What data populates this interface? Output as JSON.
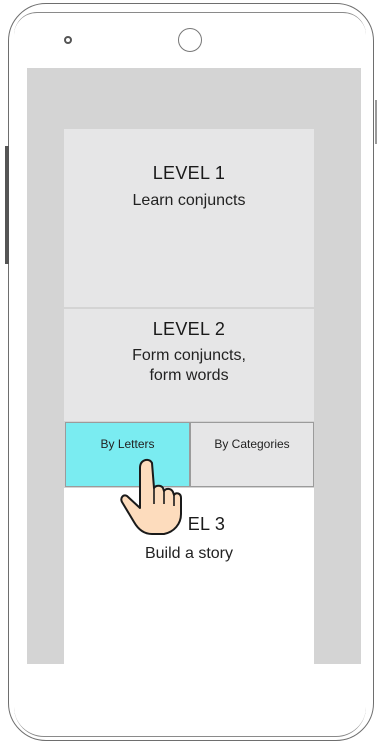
{
  "levels": [
    {
      "title": "LEVEL 1",
      "subtitle": "Learn conjuncts"
    },
    {
      "title": "LEVEL 2",
      "subtitle_line1": "Form conjuncts,",
      "subtitle_line2": "form words"
    },
    {
      "title_visible": "EL 3",
      "subtitle": "Build a story"
    }
  ],
  "tabs": [
    {
      "label": "By Letters",
      "selected": true
    },
    {
      "label": "By Categories",
      "selected": false
    }
  ],
  "colors": {
    "screen_bg": "#d4d4d4",
    "panel_bg": "#e6e6e7",
    "selected_tab": "#7aecf1",
    "hand_skin": "#fddcbd"
  },
  "icons": [
    "pointing-hand-icon",
    "camera-icon",
    "speaker-icon"
  ]
}
